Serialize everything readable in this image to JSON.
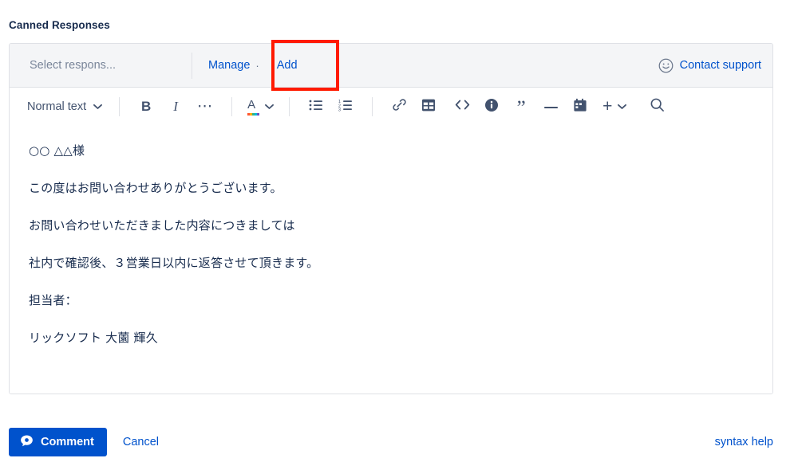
{
  "section": {
    "title": "Canned Responses"
  },
  "canned_bar": {
    "select_placeholder": "Select respons...",
    "manage_label": "Manage",
    "separator": "·",
    "add_label": "Add",
    "contact_support_label": "Contact support",
    "smiley_icon": "smiley-face-icon",
    "highlight_color": "#FF1A00",
    "background_color": "#F4F5F7"
  },
  "toolbar": {
    "text_style_label": "Normal text",
    "chevron_icon": "chevron-down-icon",
    "buttons": [
      {
        "name": "bold-button",
        "glyph": "B",
        "icon": "bold-icon"
      },
      {
        "name": "italic-button",
        "glyph": "I",
        "icon": "italic-icon"
      },
      {
        "name": "more-formatting-button",
        "glyph": "•••",
        "icon": "ellipsis-icon"
      },
      {
        "name": "text-color-button",
        "glyph": "A",
        "icon": "text-color-icon"
      },
      {
        "name": "bullet-list-button",
        "glyph": "",
        "icon": "bullet-list-icon"
      },
      {
        "name": "numbered-list-button",
        "glyph": "",
        "icon": "numbered-list-icon"
      },
      {
        "name": "link-button",
        "glyph": "",
        "icon": "link-icon"
      },
      {
        "name": "table-button",
        "glyph": "",
        "icon": "table-icon"
      },
      {
        "name": "code-block-button",
        "glyph": "<>",
        "icon": "code-icon"
      },
      {
        "name": "info-panel-button",
        "glyph": "i",
        "icon": "info-circle-icon"
      },
      {
        "name": "quote-button",
        "glyph": "”",
        "icon": "quote-icon"
      },
      {
        "name": "divider-button",
        "glyph": "—",
        "icon": "horizontal-rule-icon"
      },
      {
        "name": "date-button",
        "glyph": "",
        "icon": "calendar-icon"
      },
      {
        "name": "insert-more-button",
        "glyph": "+",
        "icon": "plus-icon"
      },
      {
        "name": "find-replace-button",
        "glyph": "",
        "icon": "search-icon"
      }
    ],
    "color_swatches": [
      "#FF5630",
      "#FFAB00",
      "#36B37E",
      "#00B8D9",
      "#6554C0"
    ]
  },
  "document": {
    "paragraphs": [
      "○○ △△様",
      "この度はお問い合わせありがとうございます。",
      "お問い合わせいただきました内容につきましては",
      "社内で確認後、３営業日以内に返答させて頂きます。",
      "担当者：",
      "リックソフト 大薗 輝久"
    ]
  },
  "actions": {
    "comment_label": "Comment",
    "comment_icon": "speech-bubble-icon",
    "cancel_label": "Cancel",
    "syntax_help_label": "syntax help",
    "primary_color": "#0052CC"
  }
}
